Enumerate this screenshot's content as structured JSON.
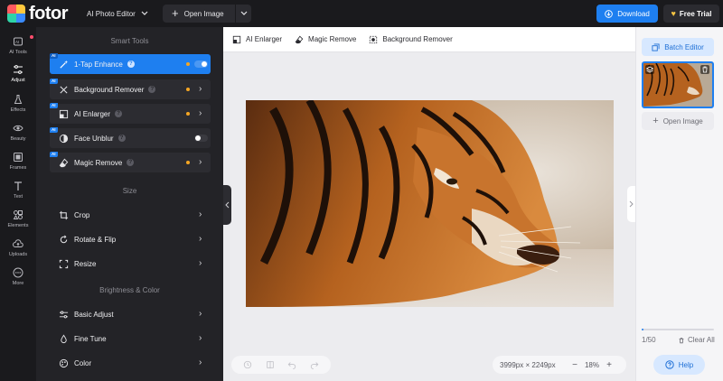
{
  "app": {
    "logo_text": "fotor",
    "product": "AI Photo Editor",
    "open_image": "Open Image",
    "download": "Download",
    "free_trial": "Free Trial",
    "accent_color": "#1e7ff0"
  },
  "rail": {
    "items": [
      {
        "label": "AI Tools",
        "icon": "ai-tools-icon"
      },
      {
        "label": "Adjust",
        "icon": "sliders-icon"
      },
      {
        "label": "Effects",
        "icon": "flask-icon"
      },
      {
        "label": "Beauty",
        "icon": "eye-icon"
      },
      {
        "label": "Frames",
        "icon": "frame-icon"
      },
      {
        "label": "Text",
        "icon": "text-icon"
      },
      {
        "label": "Elements",
        "icon": "elements-icon"
      },
      {
        "label": "Uploads",
        "icon": "upload-cloud-icon"
      },
      {
        "label": "More",
        "icon": "more-icon"
      }
    ]
  },
  "tools": {
    "smart_title": "Smart Tools",
    "smart": [
      {
        "badge": "AI",
        "label": "1-Tap Enhance",
        "help": "?",
        "control": "toggle-on"
      },
      {
        "badge": "AI",
        "label": "Background Remover",
        "help": "?",
        "control": "chevron"
      },
      {
        "badge": "AI",
        "label": "AI Enlarger",
        "help": "?",
        "control": "chevron"
      },
      {
        "badge": "AI",
        "label": "Face Unblur",
        "help": "?",
        "control": "toggle-off"
      },
      {
        "badge": "AI",
        "label": "Magic Remove",
        "help": "?",
        "control": "chevron"
      }
    ],
    "size_title": "Size",
    "size": [
      {
        "label": "Crop"
      },
      {
        "label": "Rotate & Flip"
      },
      {
        "label": "Resize"
      }
    ],
    "color_title": "Brightness & Color",
    "color": [
      {
        "label": "Basic Adjust"
      },
      {
        "label": "Fine Tune"
      },
      {
        "label": "Color"
      }
    ]
  },
  "canvas": {
    "toolbar": [
      {
        "label": "AI Enlarger",
        "icon": "enlarge-icon"
      },
      {
        "label": "Magic Remove",
        "icon": "eraser-icon"
      },
      {
        "label": "Background Remover",
        "icon": "bg-remove-icon"
      }
    ],
    "dimensions": "3999px × 2249px",
    "zoom": "18%",
    "zoom_out": "−",
    "zoom_in": "+"
  },
  "right_panel": {
    "batch_editor": "Batch Editor",
    "open_image": "Open Image",
    "count": "1/50",
    "progress": 0.02,
    "clear_all": "Clear All",
    "help": "Help"
  }
}
